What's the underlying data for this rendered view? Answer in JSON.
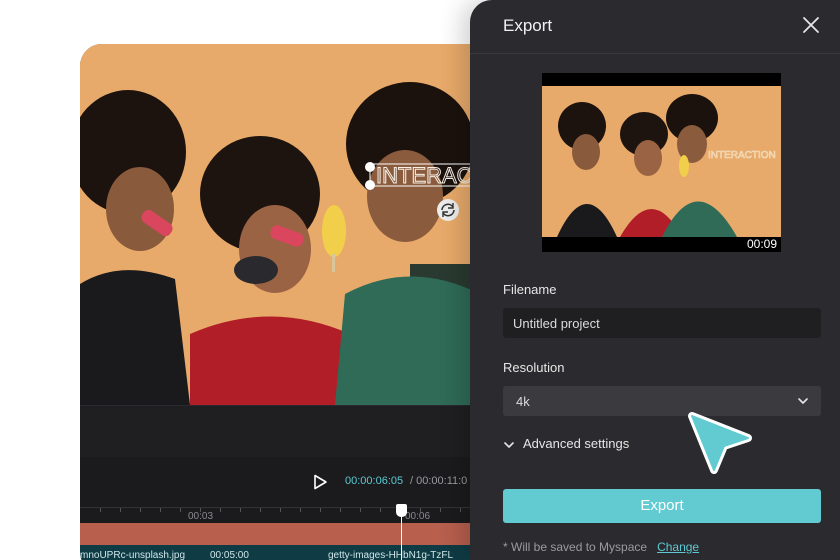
{
  "editor": {
    "overlay_text": "INTERAC",
    "timecode_current": "00:00:06:05",
    "timecode_total": "/ 00:00:11:0",
    "ruler_labels": [
      "00:03",
      "00:06"
    ],
    "track_clip_1": "mnoUPRc-unsplash.jpg",
    "track_clip_1_time": "00:05:00",
    "track_clip_2": "getty-images-HHbN1g-TzFL"
  },
  "export_panel": {
    "title": "Export",
    "thumbnail_overlay_text": "INTERACTION",
    "duration": "00:09",
    "filename_label": "Filename",
    "filename_value": "Untitled project",
    "resolution_label": "Resolution",
    "resolution_value": "4k",
    "advanced_label": "Advanced settings",
    "export_label": "Export",
    "save_note": "* Will be saved to Myspace",
    "change_label": "Change"
  },
  "colors": {
    "accent": "#62cbd2",
    "panel_bg": "#2b2b2f",
    "cursor": "#62cbd2"
  },
  "icons": {
    "close": "close-icon",
    "play": "play-icon",
    "dropdown": "chevron-down-icon",
    "refresh": "refresh-icon",
    "pointer": "cursor-arrow-icon"
  }
}
